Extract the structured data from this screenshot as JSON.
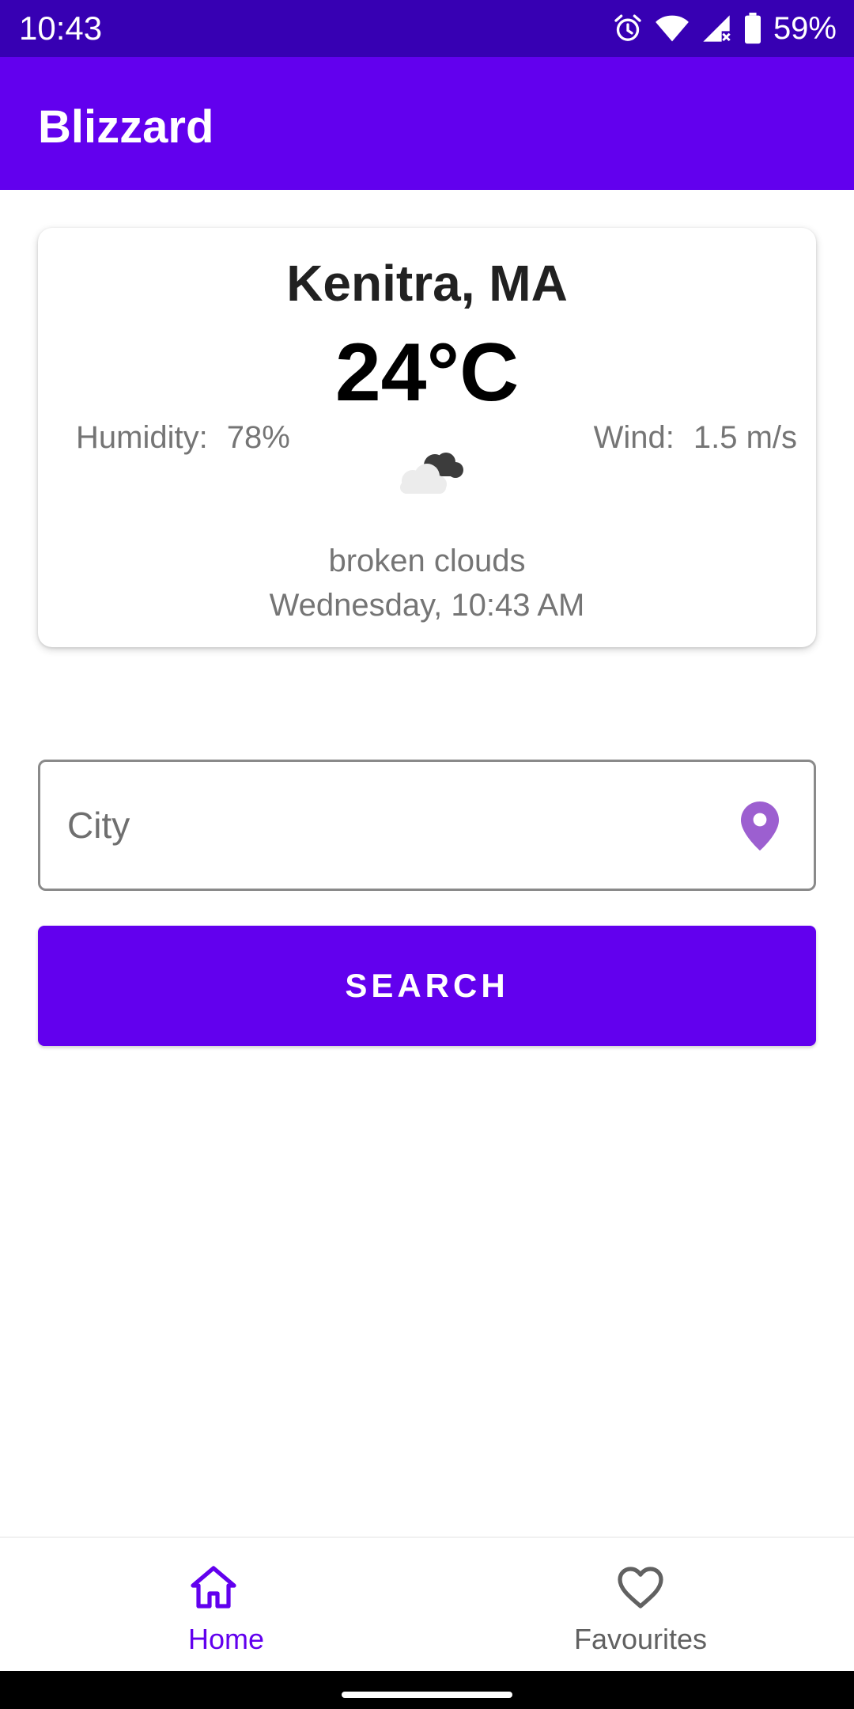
{
  "status_bar": {
    "time": "10:43",
    "battery": "59%",
    "icons": [
      "alarm-icon",
      "wifi-icon",
      "cell-signal-icon",
      "battery-icon"
    ]
  },
  "app_bar": {
    "title": "Blizzard"
  },
  "weather": {
    "city": "Kenitra, MA",
    "temperature": "24°C",
    "humidity_label": "Humidity:",
    "humidity_value": "78%",
    "wind_label": "Wind:",
    "wind_value": "1.5 m/s",
    "icon": "broken-clouds-icon",
    "condition": "broken clouds",
    "datetime": "Wednesday, 10:43 AM"
  },
  "search": {
    "placeholder": "City",
    "value": "",
    "button_label": "SEARCH",
    "trailing_icon": "location-pin-icon"
  },
  "bottom_nav": {
    "items": [
      {
        "label": "Home",
        "icon": "home-icon",
        "selected": true
      },
      {
        "label": "Favourites",
        "icon": "heart-icon",
        "selected": false
      }
    ]
  },
  "colors": {
    "status_bar": "#3700b3",
    "primary": "#6200ee",
    "pin": "#9c5fd0",
    "secondary_text": "#757575"
  }
}
